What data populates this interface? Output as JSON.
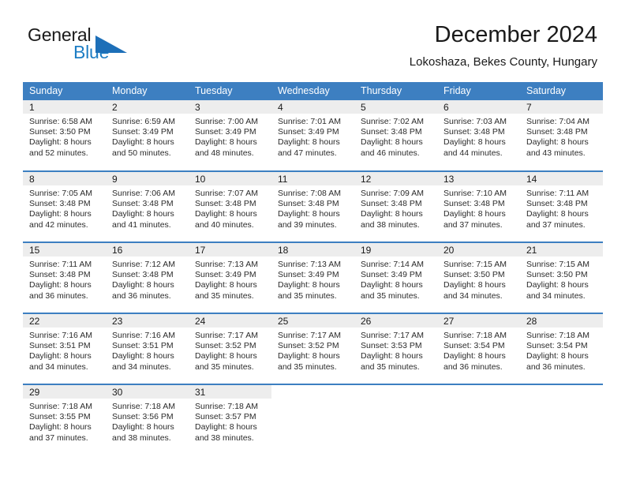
{
  "brand": {
    "name_line1": "General",
    "name_line2": "Blue",
    "logo_icon": "triangle-icon",
    "accent_color": "#1d7dc4"
  },
  "header": {
    "month_title": "December 2024",
    "location": "Lokoshaza, Bekes County, Hungary"
  },
  "theme": {
    "header_bg": "#3d7fc1",
    "daynum_bg": "#ededed",
    "text": "#1a1a1a"
  },
  "calendar": {
    "weekday_headers": [
      "Sunday",
      "Monday",
      "Tuesday",
      "Wednesday",
      "Thursday",
      "Friday",
      "Saturday"
    ],
    "weeks": [
      [
        {
          "day": "1",
          "sunrise": "Sunrise: 6:58 AM",
          "sunset": "Sunset: 3:50 PM",
          "daylight1": "Daylight: 8 hours",
          "daylight2": "and 52 minutes."
        },
        {
          "day": "2",
          "sunrise": "Sunrise: 6:59 AM",
          "sunset": "Sunset: 3:49 PM",
          "daylight1": "Daylight: 8 hours",
          "daylight2": "and 50 minutes."
        },
        {
          "day": "3",
          "sunrise": "Sunrise: 7:00 AM",
          "sunset": "Sunset: 3:49 PM",
          "daylight1": "Daylight: 8 hours",
          "daylight2": "and 48 minutes."
        },
        {
          "day": "4",
          "sunrise": "Sunrise: 7:01 AM",
          "sunset": "Sunset: 3:49 PM",
          "daylight1": "Daylight: 8 hours",
          "daylight2": "and 47 minutes."
        },
        {
          "day": "5",
          "sunrise": "Sunrise: 7:02 AM",
          "sunset": "Sunset: 3:48 PM",
          "daylight1": "Daylight: 8 hours",
          "daylight2": "and 46 minutes."
        },
        {
          "day": "6",
          "sunrise": "Sunrise: 7:03 AM",
          "sunset": "Sunset: 3:48 PM",
          "daylight1": "Daylight: 8 hours",
          "daylight2": "and 44 minutes."
        },
        {
          "day": "7",
          "sunrise": "Sunrise: 7:04 AM",
          "sunset": "Sunset: 3:48 PM",
          "daylight1": "Daylight: 8 hours",
          "daylight2": "and 43 minutes."
        }
      ],
      [
        {
          "day": "8",
          "sunrise": "Sunrise: 7:05 AM",
          "sunset": "Sunset: 3:48 PM",
          "daylight1": "Daylight: 8 hours",
          "daylight2": "and 42 minutes."
        },
        {
          "day": "9",
          "sunrise": "Sunrise: 7:06 AM",
          "sunset": "Sunset: 3:48 PM",
          "daylight1": "Daylight: 8 hours",
          "daylight2": "and 41 minutes."
        },
        {
          "day": "10",
          "sunrise": "Sunrise: 7:07 AM",
          "sunset": "Sunset: 3:48 PM",
          "daylight1": "Daylight: 8 hours",
          "daylight2": "and 40 minutes."
        },
        {
          "day": "11",
          "sunrise": "Sunrise: 7:08 AM",
          "sunset": "Sunset: 3:48 PM",
          "daylight1": "Daylight: 8 hours",
          "daylight2": "and 39 minutes."
        },
        {
          "day": "12",
          "sunrise": "Sunrise: 7:09 AM",
          "sunset": "Sunset: 3:48 PM",
          "daylight1": "Daylight: 8 hours",
          "daylight2": "and 38 minutes."
        },
        {
          "day": "13",
          "sunrise": "Sunrise: 7:10 AM",
          "sunset": "Sunset: 3:48 PM",
          "daylight1": "Daylight: 8 hours",
          "daylight2": "and 37 minutes."
        },
        {
          "day": "14",
          "sunrise": "Sunrise: 7:11 AM",
          "sunset": "Sunset: 3:48 PM",
          "daylight1": "Daylight: 8 hours",
          "daylight2": "and 37 minutes."
        }
      ],
      [
        {
          "day": "15",
          "sunrise": "Sunrise: 7:11 AM",
          "sunset": "Sunset: 3:48 PM",
          "daylight1": "Daylight: 8 hours",
          "daylight2": "and 36 minutes."
        },
        {
          "day": "16",
          "sunrise": "Sunrise: 7:12 AM",
          "sunset": "Sunset: 3:48 PM",
          "daylight1": "Daylight: 8 hours",
          "daylight2": "and 36 minutes."
        },
        {
          "day": "17",
          "sunrise": "Sunrise: 7:13 AM",
          "sunset": "Sunset: 3:49 PM",
          "daylight1": "Daylight: 8 hours",
          "daylight2": "and 35 minutes."
        },
        {
          "day": "18",
          "sunrise": "Sunrise: 7:13 AM",
          "sunset": "Sunset: 3:49 PM",
          "daylight1": "Daylight: 8 hours",
          "daylight2": "and 35 minutes."
        },
        {
          "day": "19",
          "sunrise": "Sunrise: 7:14 AM",
          "sunset": "Sunset: 3:49 PM",
          "daylight1": "Daylight: 8 hours",
          "daylight2": "and 35 minutes."
        },
        {
          "day": "20",
          "sunrise": "Sunrise: 7:15 AM",
          "sunset": "Sunset: 3:50 PM",
          "daylight1": "Daylight: 8 hours",
          "daylight2": "and 34 minutes."
        },
        {
          "day": "21",
          "sunrise": "Sunrise: 7:15 AM",
          "sunset": "Sunset: 3:50 PM",
          "daylight1": "Daylight: 8 hours",
          "daylight2": "and 34 minutes."
        }
      ],
      [
        {
          "day": "22",
          "sunrise": "Sunrise: 7:16 AM",
          "sunset": "Sunset: 3:51 PM",
          "daylight1": "Daylight: 8 hours",
          "daylight2": "and 34 minutes."
        },
        {
          "day": "23",
          "sunrise": "Sunrise: 7:16 AM",
          "sunset": "Sunset: 3:51 PM",
          "daylight1": "Daylight: 8 hours",
          "daylight2": "and 34 minutes."
        },
        {
          "day": "24",
          "sunrise": "Sunrise: 7:17 AM",
          "sunset": "Sunset: 3:52 PM",
          "daylight1": "Daylight: 8 hours",
          "daylight2": "and 35 minutes."
        },
        {
          "day": "25",
          "sunrise": "Sunrise: 7:17 AM",
          "sunset": "Sunset: 3:52 PM",
          "daylight1": "Daylight: 8 hours",
          "daylight2": "and 35 minutes."
        },
        {
          "day": "26",
          "sunrise": "Sunrise: 7:17 AM",
          "sunset": "Sunset: 3:53 PM",
          "daylight1": "Daylight: 8 hours",
          "daylight2": "and 35 minutes."
        },
        {
          "day": "27",
          "sunrise": "Sunrise: 7:18 AM",
          "sunset": "Sunset: 3:54 PM",
          "daylight1": "Daylight: 8 hours",
          "daylight2": "and 36 minutes."
        },
        {
          "day": "28",
          "sunrise": "Sunrise: 7:18 AM",
          "sunset": "Sunset: 3:54 PM",
          "daylight1": "Daylight: 8 hours",
          "daylight2": "and 36 minutes."
        }
      ],
      [
        {
          "day": "29",
          "sunrise": "Sunrise: 7:18 AM",
          "sunset": "Sunset: 3:55 PM",
          "daylight1": "Daylight: 8 hours",
          "daylight2": "and 37 minutes."
        },
        {
          "day": "30",
          "sunrise": "Sunrise: 7:18 AM",
          "sunset": "Sunset: 3:56 PM",
          "daylight1": "Daylight: 8 hours",
          "daylight2": "and 38 minutes."
        },
        {
          "day": "31",
          "sunrise": "Sunrise: 7:18 AM",
          "sunset": "Sunset: 3:57 PM",
          "daylight1": "Daylight: 8 hours",
          "daylight2": "and 38 minutes."
        },
        {
          "day": "",
          "sunrise": "",
          "sunset": "",
          "daylight1": "",
          "daylight2": ""
        },
        {
          "day": "",
          "sunrise": "",
          "sunset": "",
          "daylight1": "",
          "daylight2": ""
        },
        {
          "day": "",
          "sunrise": "",
          "sunset": "",
          "daylight1": "",
          "daylight2": ""
        },
        {
          "day": "",
          "sunrise": "",
          "sunset": "",
          "daylight1": "",
          "daylight2": ""
        }
      ]
    ]
  }
}
